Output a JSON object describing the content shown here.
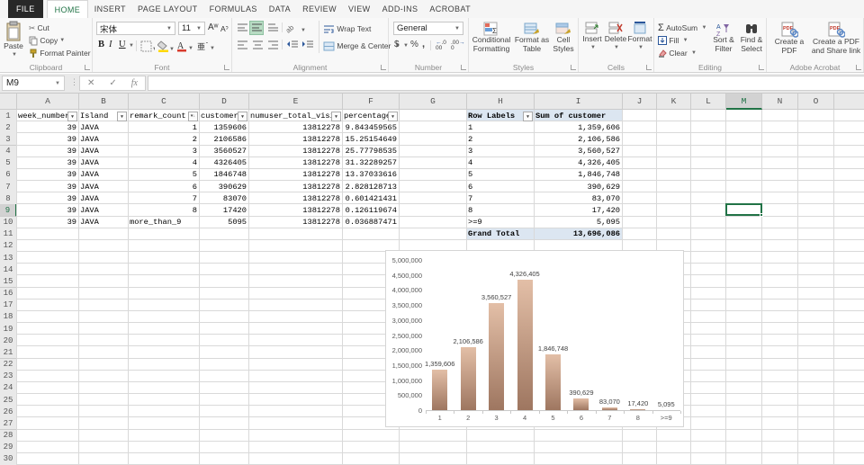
{
  "tabs": [
    {
      "label": "FILE",
      "type": "file"
    },
    {
      "label": "HOME",
      "type": "active"
    },
    {
      "label": "INSERT",
      "type": "normal"
    },
    {
      "label": "PAGE LAYOUT",
      "type": "normal"
    },
    {
      "label": "FORMULAS",
      "type": "normal"
    },
    {
      "label": "DATA",
      "type": "normal"
    },
    {
      "label": "REVIEW",
      "type": "normal"
    },
    {
      "label": "VIEW",
      "type": "normal"
    },
    {
      "label": "ADD-INS",
      "type": "normal"
    },
    {
      "label": "ACROBAT",
      "type": "normal"
    }
  ],
  "ribbon": {
    "clipboard": {
      "label": "Clipboard",
      "paste": "Paste",
      "cut": "Cut",
      "copy": "Copy",
      "format_painter": "Format Painter"
    },
    "font": {
      "label": "Font",
      "font_name": "宋体",
      "font_size": "11"
    },
    "alignment": {
      "label": "Alignment",
      "wrap_text": "Wrap Text",
      "merge_center": "Merge & Center"
    },
    "number": {
      "label": "Number",
      "format": "General"
    },
    "styles": {
      "label": "Styles",
      "conditional": "Conditional Formatting",
      "format_table": "Format as Table",
      "cell_styles": "Cell Styles"
    },
    "cells": {
      "label": "Cells",
      "insert": "Insert",
      "delete": "Delete",
      "format": "Format"
    },
    "editing": {
      "label": "Editing",
      "autosum": "AutoSum",
      "fill": "Fill",
      "clear": "Clear",
      "sort_filter": "Sort & Filter",
      "find_select": "Find & Select"
    },
    "acrobat": {
      "label": "Adobe Acrobat",
      "create_pdf": "Create a PDF",
      "share_link": "Create a PDF and Share link"
    }
  },
  "formula_bar": {
    "name_box": "M9",
    "formula": ""
  },
  "sheet": {
    "columns": [
      "A",
      "B",
      "C",
      "D",
      "E",
      "F",
      "G",
      "H",
      "I",
      "J",
      "K",
      "L",
      "M",
      "N",
      "O"
    ],
    "row_count": 30,
    "selected": {
      "col": "M",
      "row": 9
    },
    "data_table": {
      "headers": [
        "week_number",
        "Island",
        "remark_count",
        "customer",
        "numuser_total_visit",
        "percentage"
      ],
      "sorted_column": "remark_count",
      "rows": [
        [
          "39",
          "JAVA",
          "1",
          "1359606",
          "13812278",
          "9.843459565"
        ],
        [
          "39",
          "JAVA",
          "2",
          "2106586",
          "13812278",
          "15.25154649"
        ],
        [
          "39",
          "JAVA",
          "3",
          "3560527",
          "13812278",
          "25.77798535"
        ],
        [
          "39",
          "JAVA",
          "4",
          "4326405",
          "13812278",
          "31.32289257"
        ],
        [
          "39",
          "JAVA",
          "5",
          "1846748",
          "13812278",
          "13.37033616"
        ],
        [
          "39",
          "JAVA",
          "6",
          "390629",
          "13812278",
          "2.828128713"
        ],
        [
          "39",
          "JAVA",
          "7",
          "83070",
          "13812278",
          "0.601421431"
        ],
        [
          "39",
          "JAVA",
          "8",
          "17420",
          "13812278",
          "0.126119674"
        ],
        [
          "39",
          "JAVA",
          "more_than_9",
          "5095",
          "13812278",
          "0.036887471"
        ]
      ]
    },
    "pivot": {
      "header": [
        "Row Labels",
        "Sum of customer"
      ],
      "rows": [
        [
          "1",
          "1,359,606"
        ],
        [
          "2",
          "2,106,586"
        ],
        [
          "3",
          "3,560,527"
        ],
        [
          "4",
          "4,326,405"
        ],
        [
          "5",
          "1,846,748"
        ],
        [
          "6",
          "390,629"
        ],
        [
          "7",
          "83,070"
        ],
        [
          "8",
          "17,420"
        ],
        [
          ">=9",
          "5,095"
        ]
      ],
      "grand_total": [
        "Grand Total",
        "13,696,086"
      ],
      "header_bg": "#dce6f1"
    }
  },
  "chart_data": {
    "type": "bar",
    "categories": [
      "1",
      "2",
      "3",
      "4",
      "5",
      "6",
      "7",
      "8",
      ">=9"
    ],
    "values": [
      1359606,
      2106586,
      3560527,
      4326405,
      1846748,
      390629,
      83070,
      17420,
      5095
    ],
    "data_labels": [
      "1,359,606",
      "2,106,586",
      "3,560,527",
      "4,326,405",
      "1,846,748",
      "390,629",
      "83,070",
      "17,420",
      "5,095"
    ],
    "ylim": [
      0,
      5000000
    ],
    "ytick_step": 500000,
    "ytick_labels": [
      "0",
      "500,000",
      "1,000,000",
      "1,500,000",
      "2,000,000",
      "2,500,000",
      "3,000,000",
      "3,500,000",
      "4,000,000",
      "4,500,000",
      "5,000,000"
    ],
    "bar_color_top": "#e3bfa7",
    "bar_color_bottom": "#9e7660",
    "title": "",
    "xlabel": "",
    "ylabel": ""
  },
  "colors": {
    "accent_green": "#217346",
    "pivot_blue": "#dce6f1"
  }
}
